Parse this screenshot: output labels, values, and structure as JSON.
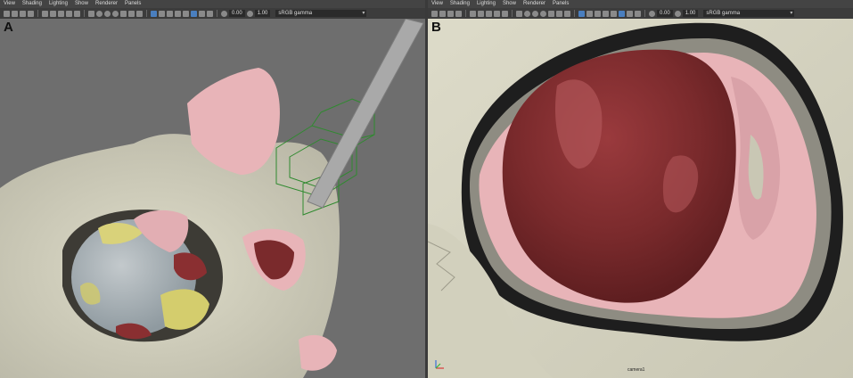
{
  "panels": [
    {
      "letter": "A",
      "menu": [
        "View",
        "Shading",
        "Lighting",
        "Show",
        "Renderer",
        "Panels"
      ],
      "toolbar": {
        "field1": "0.00",
        "field2": "1.00",
        "colorspace": "sRGB gamma"
      }
    },
    {
      "letter": "B",
      "menu": [
        "View",
        "Shading",
        "Lighting",
        "Show",
        "Renderer",
        "Panels"
      ],
      "toolbar": {
        "field1": "0.00",
        "field2": "1.00",
        "colorspace": "sRGB gamma"
      },
      "camera_label": "camera1"
    }
  ],
  "colors": {
    "bone": "#d7d5c4",
    "soft_tissue": "#e8b4b8",
    "tumor": "#7a2a2c",
    "yellow_tissue": "#d9d27a",
    "viewport_gray": "#6e6e6e"
  }
}
